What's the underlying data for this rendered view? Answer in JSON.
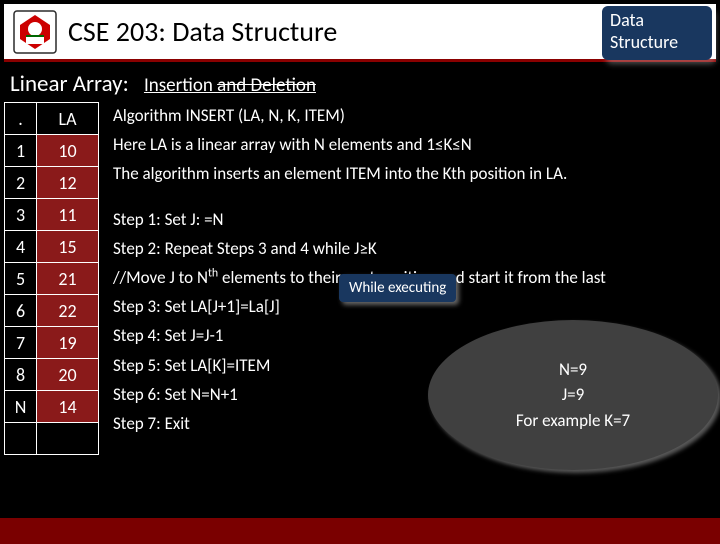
{
  "header": {
    "course_title": "CSE 203: Data Structure",
    "badge_line1": "Data",
    "badge_line2": "Structure"
  },
  "section": {
    "heading": "Linear Array:",
    "sub_keep": "Insertion ",
    "sub_strike": "and Deletion"
  },
  "table": {
    "h1": ".",
    "h2": "LA",
    "rows": [
      {
        "i": "1",
        "v": "10"
      },
      {
        "i": "2",
        "v": "12"
      },
      {
        "i": "3",
        "v": "11"
      },
      {
        "i": "4",
        "v": "15"
      },
      {
        "i": "5",
        "v": "21"
      },
      {
        "i": "6",
        "v": "22"
      },
      {
        "i": "7",
        "v": "19"
      },
      {
        "i": "8",
        "v": "20"
      },
      {
        "i": "N",
        "v": "14"
      }
    ]
  },
  "algo": {
    "l1": "Algorithm INSERT (LA, N, K, ITEM)",
    "l2": "Here LA is a linear array with N elements and 1≤K≤N",
    "l3": "The algorithm inserts an element ITEM into the Kth position in LA.",
    "s1": "Step 1: Set J: =N",
    "s2": "Step 2: Repeat Steps 3 and 4 while J≥K",
    "s3a": "//Move J to N",
    "s3b": " elements to their next position and start  it from the last",
    "s4": "Step 3: Set LA[J+1]=La[J]",
    "s5": "Step 4: Set J=J-1",
    "s6": "Step 5: Set LA[K]=ITEM",
    "s7": "Step 6: Set N=N+1",
    "s8": "Step 7: Exit",
    "while_cap": "While executing"
  },
  "bubble": {
    "l1": "N=9",
    "l2": "J=9",
    "l3": "For example K=7"
  }
}
